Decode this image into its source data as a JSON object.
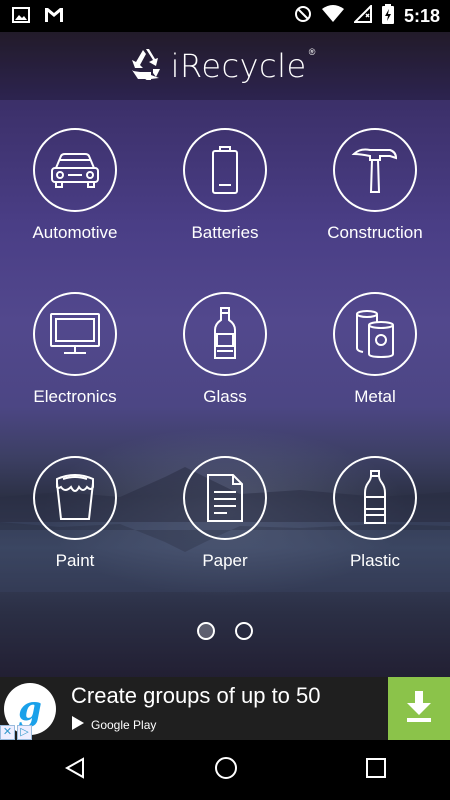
{
  "status_bar": {
    "time": "5:18",
    "left_icons": [
      "image-icon",
      "gmail-icon"
    ],
    "right_icons": [
      "no-sim-icon",
      "wifi-icon",
      "cell-signal-icon",
      "battery-icon"
    ]
  },
  "header": {
    "title": "iRecycle",
    "registered": "®",
    "logo_icon": "recycle-icon"
  },
  "categories": [
    {
      "label": "Automotive",
      "icon": "car-icon"
    },
    {
      "label": "Batteries",
      "icon": "battery-icon"
    },
    {
      "label": "Construction",
      "icon": "hammer-icon"
    },
    {
      "label": "Electronics",
      "icon": "monitor-icon"
    },
    {
      "label": "Glass",
      "icon": "glass-bottle-icon"
    },
    {
      "label": "Metal",
      "icon": "cans-icon"
    },
    {
      "label": "Paint",
      "icon": "paint-bucket-icon"
    },
    {
      "label": "Paper",
      "icon": "document-icon"
    },
    {
      "label": "Plastic",
      "icon": "plastic-bottle-icon"
    }
  ],
  "pager": {
    "pages": 2,
    "current": 1
  },
  "ad": {
    "text": "Create groups of up to 50",
    "store": "Google Play",
    "logo_letter": "g",
    "colors": {
      "download_bg": "#8bc34a",
      "logo": "#1aa1ea"
    }
  },
  "nav": [
    "back-icon",
    "home-icon",
    "recents-icon"
  ],
  "colors": {
    "accent": "#ffffff",
    "bg_top": "#3b2f68",
    "bg_mid": "#52488d"
  }
}
